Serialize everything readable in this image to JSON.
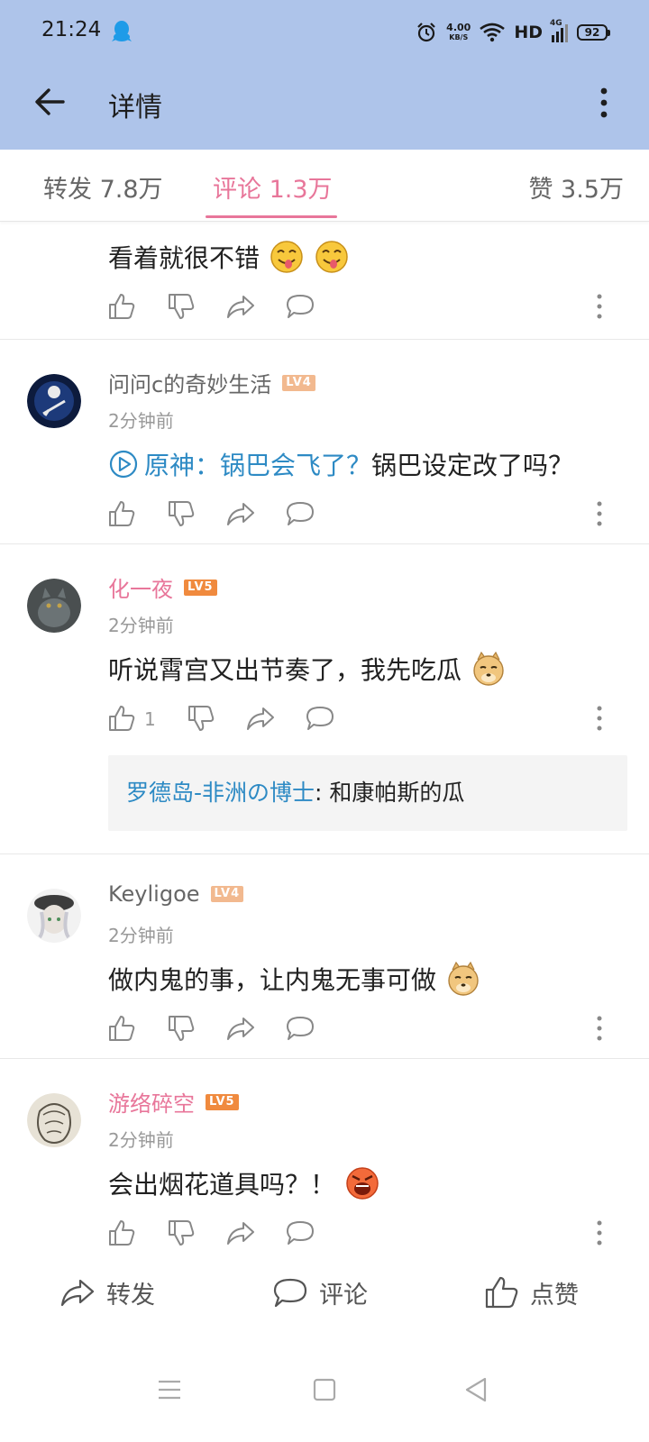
{
  "status": {
    "time": "21:24",
    "speed_value": "4.00",
    "speed_unit": "KB/S",
    "hd": "HD",
    "network": "4G",
    "battery": "92"
  },
  "appbar": {
    "title": "详情"
  },
  "tabs": {
    "forward": "转发 7.8万",
    "comment": "评论 1.3万",
    "like": "赞 3.5万"
  },
  "colors": {
    "accent": "#e8769a",
    "header": "#aec4ea",
    "link": "#2d8ac4",
    "lv4": "#f2b98f",
    "lv5": "#f08a3e"
  },
  "comments": [
    {
      "text": "看着就很不错",
      "emoji": "tongue-emoji"
    },
    {
      "name": "问问c的奇妙生活",
      "level": "LV4",
      "time": "2分钟前",
      "link_text": "原神：锅巴会飞了？",
      "text": "锅巴设定改了吗？"
    },
    {
      "name": "化一夜",
      "level": "LV5",
      "time": "2分钟前",
      "text": "听说霄宫又出节奏了，我先吃瓜",
      "emoji": "doge-emoji",
      "likes": "1",
      "reply": {
        "author": "罗德岛-非洲の博士",
        "sep": ": ",
        "text": "和康帕斯的瓜"
      }
    },
    {
      "name": "Keyligoe",
      "level": "LV4",
      "time": "2分钟前",
      "text": "做内鬼的事，让内鬼无事可做",
      "emoji": "doge-emoji"
    },
    {
      "name": "游络碎空",
      "level": "LV5",
      "time": "2分钟前",
      "text": "会出烟花道具吗？！",
      "emoji": "angry-emoji"
    }
  ],
  "bottom": {
    "forward": "转发",
    "comment": "评论",
    "like": "点赞"
  }
}
